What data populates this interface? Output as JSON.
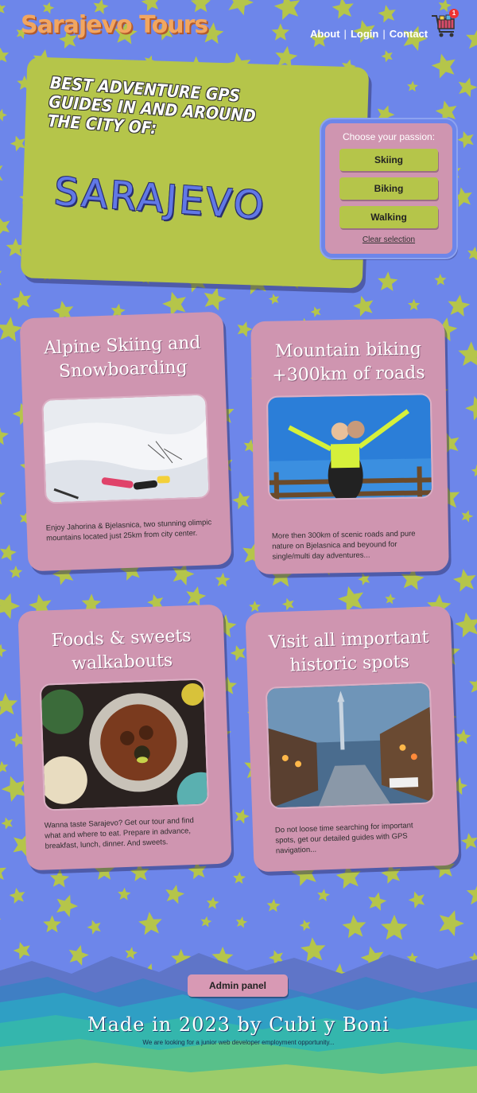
{
  "header": {
    "brand": "Sarajevo Tours",
    "nav": [
      {
        "label": "About"
      },
      {
        "label": "Login"
      },
      {
        "label": "Contact"
      }
    ],
    "separator": "|",
    "cart_count": "1"
  },
  "hero": {
    "tagline": "Best adventure GPS guides in and around the city of:",
    "city": "Sarajevo"
  },
  "picker": {
    "label": "Choose your passion:",
    "options": [
      "Skiing",
      "Biking",
      "Walking"
    ],
    "clear": "Clear selection"
  },
  "cards": [
    {
      "title": "Alpine Skiing and Snowboarding",
      "text": "Enjoy Jahorina & Bjelasnica, two stunning olimpic mountains located just 25km from city center."
    },
    {
      "title": "Mountain biking +300km of roads",
      "text": "More then 300km of scenic roads and pure nature on Bjelasnica and beyound for single/multi day adventures..."
    },
    {
      "title": "Foods & sweets walkabouts",
      "text": "Wanna taste Sarajevo? Get our tour and find what and where to eat. Prepare in advance, breakfast, lunch, dinner. And sweets."
    },
    {
      "title": "Visit all important historic spots",
      "text": "Do not loose time searching for important spots, get our detailed guides with GPS navigation..."
    }
  ],
  "admin": {
    "label": "Admin panel"
  },
  "footer": {
    "title": "Made in 2023 by Cubi y Boni",
    "subtitle": "We are looking for a junior web developer employment opportunity..."
  },
  "colors": {
    "background": "#6d86ea",
    "star": "#b5c54a",
    "card": "#cf95b0",
    "brand": "#f2a660",
    "hero": "#b5c54a"
  }
}
